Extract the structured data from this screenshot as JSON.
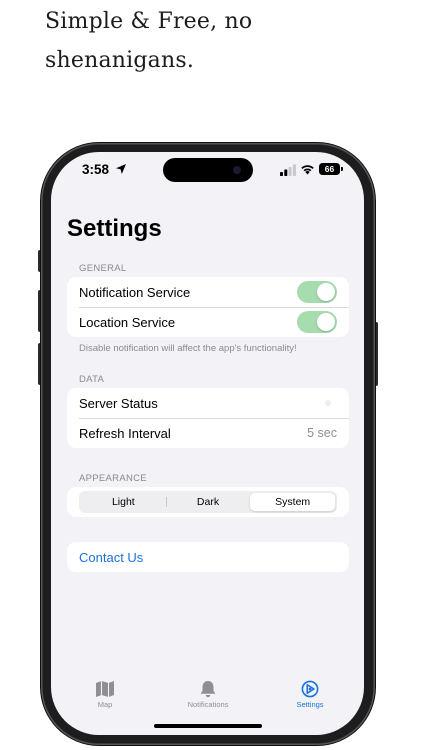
{
  "headline": [
    "Simple & Free, no",
    "shenanigans."
  ],
  "status_bar": {
    "time": "3:58",
    "battery": "66"
  },
  "settings": {
    "title": "Settings",
    "general": {
      "header": "GENERAL",
      "notification_label": "Notification Service",
      "notification_on": true,
      "location_label": "Location Service",
      "location_on": true,
      "footer": "Disable notification will affect the app's functionality!"
    },
    "data": {
      "header": "DATA",
      "server_status_label": "Server Status",
      "refresh_label": "Refresh Interval",
      "refresh_value": "5 sec"
    },
    "appearance": {
      "header": "APPEARANCE",
      "options": [
        "Light",
        "Dark",
        "System"
      ],
      "selected": "System"
    },
    "contact_label": "Contact Us"
  },
  "tab_bar": {
    "tabs": [
      {
        "label": "Map",
        "icon": "map-icon"
      },
      {
        "label": "Notifications",
        "icon": "bell-icon"
      },
      {
        "label": "Settings",
        "icon": "settings-icon"
      }
    ],
    "active_tab": "Settings"
  },
  "colors": {
    "accent": "#1a73d9",
    "toggle_on": "#a7dcae",
    "inactive_tab": "#8e8e93"
  }
}
